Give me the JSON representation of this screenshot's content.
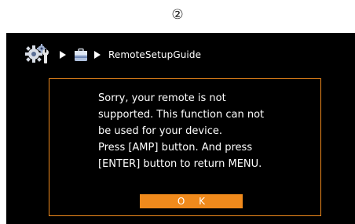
{
  "step_marker": "②",
  "breadcrumb": {
    "icons": [
      "settings-gears-icon",
      "toolbox-icon"
    ],
    "current": "RemoteSetupGuide"
  },
  "dialog": {
    "message": "Sorry, your remote is not\nsupported. This function can not\nbe used for your device.\nPress [AMP] button. And press\n[ENTER] button to return MENU.",
    "ok_label": "O K"
  },
  "colors": {
    "accent": "#f08a1c",
    "screen_bg": "#000000",
    "text": "#ffffff"
  }
}
